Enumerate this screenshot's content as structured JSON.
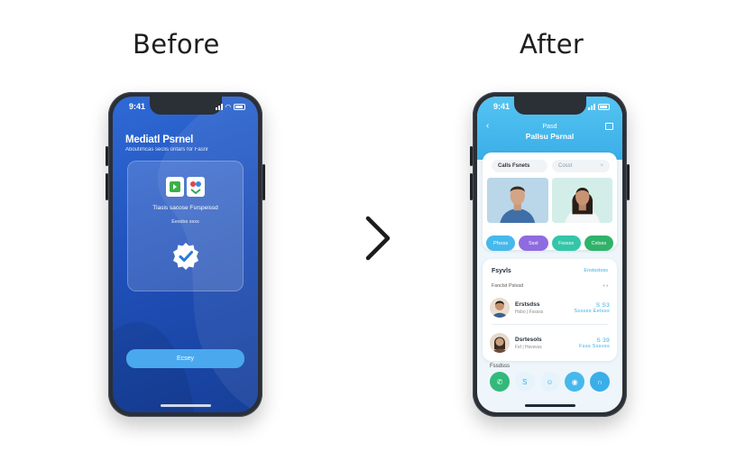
{
  "headings": {
    "before": "Before",
    "after": "After"
  },
  "before_phone": {
    "status_time": "9:41",
    "title": "Mediatl Psrnel",
    "subtitle": "Aboutimcas seclis ontars for Fasnr",
    "card_label": "Tlasis sacose Fsrspeissd",
    "card_sub": "Eesdss ssxs",
    "button_label": "Ecsey",
    "colors": {
      "bg": "#2f6ad6",
      "button": "#4aa8ef"
    }
  },
  "after_phone": {
    "status_time": "9:41",
    "header_kicker": "Pasd",
    "header_title": "Pallsu Psrnal",
    "tab_label": "Calls Fsnets",
    "search_placeholder": "Cosst",
    "chips": [
      {
        "label": "Pfssss",
        "color": "#46b9ec"
      },
      {
        "label": "Ssst",
        "color": "#8f6be0"
      },
      {
        "label": "Fsssss",
        "color": "#33c6a8"
      },
      {
        "label": "Cstsss",
        "color": "#2fb36a"
      }
    ],
    "list_title": "Fsyvls",
    "list_link": "Enstsstoss",
    "list_sub": "Fsnclst Pslvsd",
    "list_sub_right": "‹ ›",
    "rows": [
      {
        "name": "Erstsdss",
        "meta": "Hsbo  |  Fsssss",
        "value": "Sssses Eetsss",
        "code": "S S3"
      },
      {
        "name": "Dsrtesols",
        "meta": "Fsf  |  Hsvsvss",
        "value": "Fsss Sssvss",
        "code": "S 39"
      }
    ],
    "dock_label": "Fssdsss",
    "dock": [
      {
        "icon": "phone-icon",
        "glyph": "✆",
        "color": "#33b97a"
      },
      {
        "icon": "s-icon",
        "glyph": "S",
        "color": "#e6f3fb"
      },
      {
        "icon": "contact-icon",
        "glyph": "☺",
        "color": "#e6f3fb"
      },
      {
        "icon": "badge-icon",
        "glyph": "◉",
        "color": "#46b9ec"
      },
      {
        "icon": "n-icon",
        "glyph": "∩",
        "color": "#3aaee8"
      }
    ],
    "colors": {
      "accent": "#3aaee8",
      "bg": "#eef6fb"
    }
  }
}
